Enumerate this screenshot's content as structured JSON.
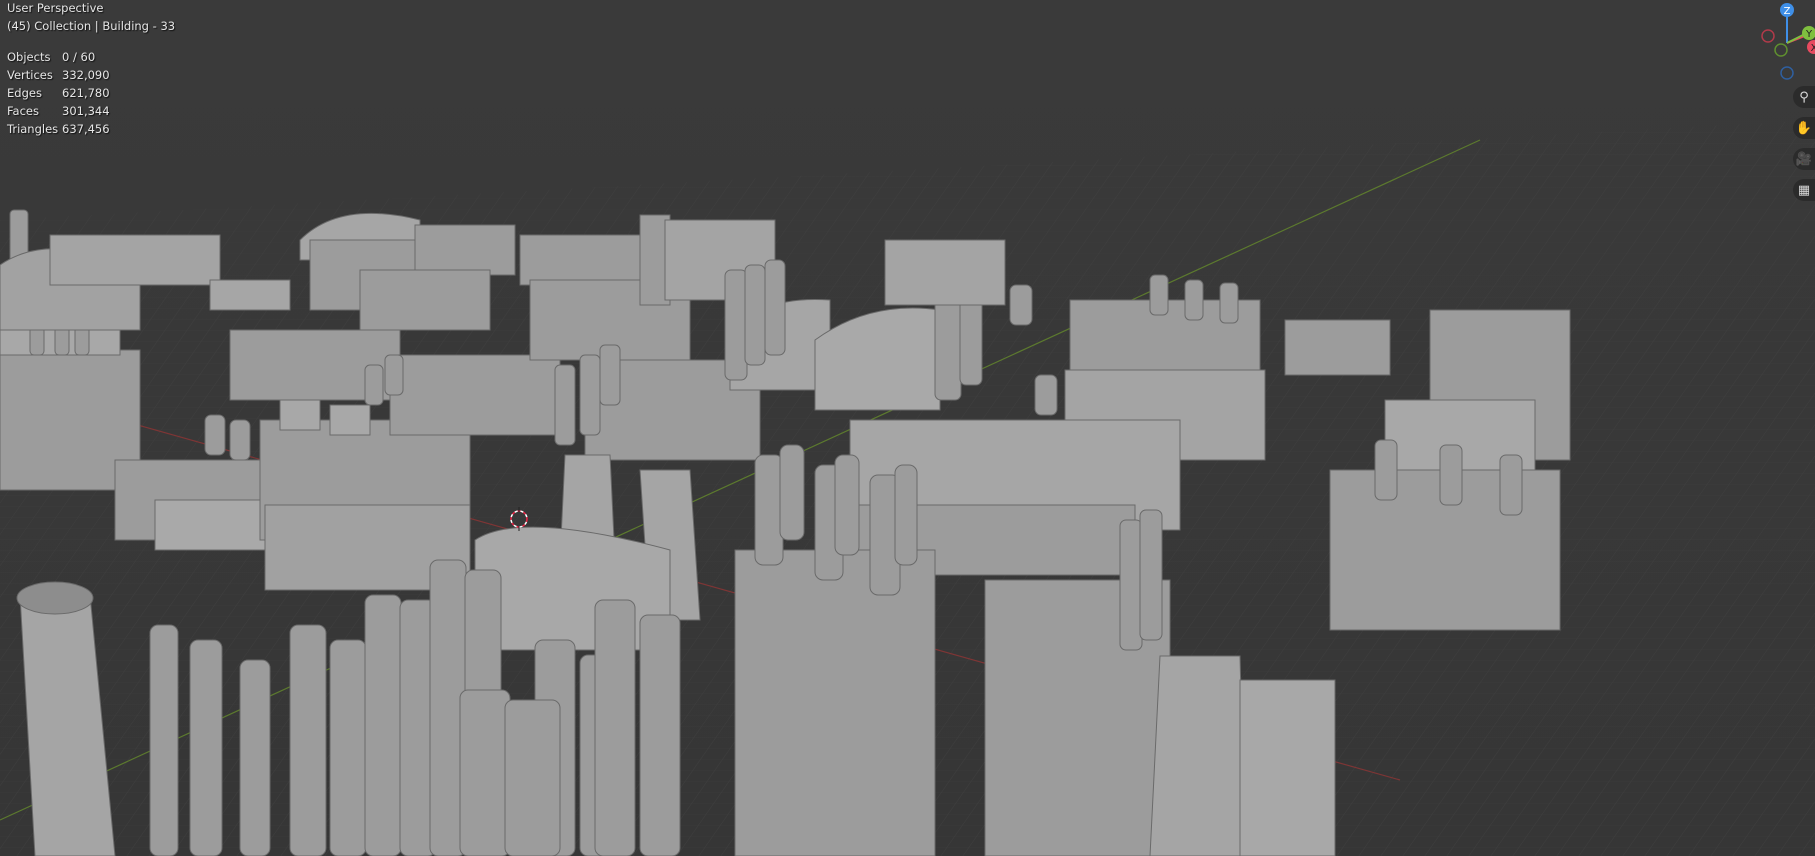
{
  "viewport": {
    "view_name": "User Perspective",
    "collection_info": "(45) Collection | Building - 33"
  },
  "stats": [
    {
      "label": "Objects",
      "value": "0 / 60"
    },
    {
      "label": "Vertices",
      "value": "332,090"
    },
    {
      "label": "Edges",
      "value": "621,780"
    },
    {
      "label": "Faces",
      "value": "301,344"
    },
    {
      "label": "Triangles",
      "value": "637,456"
    }
  ],
  "gizmo": {
    "z_label": "Z",
    "y_label": "Y",
    "x_label": "X",
    "colors": {
      "x": "#e84a5f",
      "y": "#7fbf3f",
      "z": "#3f8fe8"
    }
  },
  "nav_tools": [
    {
      "name": "zoom-icon",
      "glyph": "⚲"
    },
    {
      "name": "pan-hand-icon",
      "glyph": "✋"
    },
    {
      "name": "camera-view-icon",
      "glyph": "🎥"
    },
    {
      "name": "ortho-grid-icon",
      "glyph": "▦"
    }
  ],
  "colors": {
    "background": "#393939",
    "grid": "#444444",
    "x_axis": "#8a3a3a",
    "y_axis": "#5f7f2f",
    "model": "#9a9a9a"
  }
}
